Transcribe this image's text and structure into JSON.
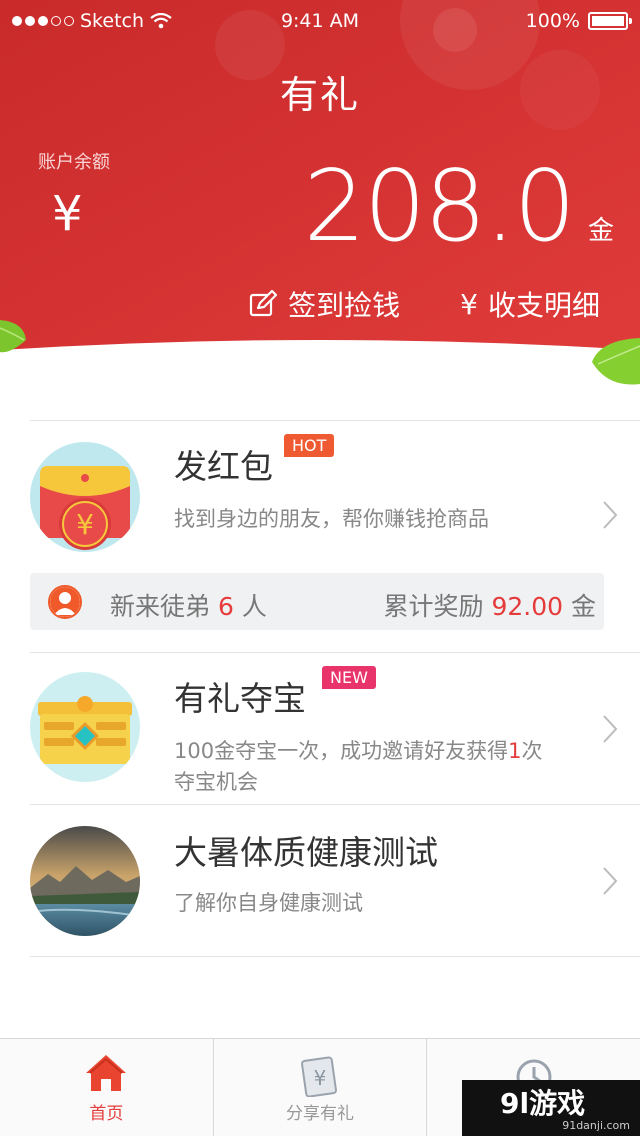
{
  "status_bar": {
    "carrier": "Sketch",
    "time": "9:41 AM",
    "battery": "100%"
  },
  "header": {
    "title": "有礼",
    "balance_label": "账户余额",
    "currency_symbol": "¥",
    "balance": "208.0",
    "unit": "金",
    "checkin_label": "签到捡钱",
    "records_label": "收支明细",
    "colors": {
      "header_red": "#d83131"
    }
  },
  "items": [
    {
      "title": "发红包",
      "badge": "HOT",
      "desc": "找到身边的朋友，帮你赚钱抢商品",
      "icon": "red-envelope-icon"
    },
    {
      "title": "有礼夺宝",
      "badge": "NEW",
      "desc_a": "100金夺宝一次，成功邀请好友获得",
      "desc_hl": "1",
      "desc_b": "次",
      "desc2": "夺宝机会",
      "icon": "treasure-chest-icon"
    },
    {
      "title": "大暑体质健康测试",
      "desc": "了解你自身健康测试",
      "icon": "landscape-photo"
    }
  ],
  "recruit": {
    "label": "新来徒弟",
    "count": "6",
    "count_unit": "人",
    "reward_label": "累计奖励",
    "reward": "92.00",
    "reward_unit": "金"
  },
  "tabbar": {
    "tabs": [
      {
        "label": "首页",
        "icon": "home-icon"
      },
      {
        "label": "分享有礼",
        "icon": "share-gift-icon"
      },
      {
        "label": "",
        "icon": "history-icon"
      }
    ],
    "accent": "#e53b3b"
  },
  "watermark": {
    "main": "9l游戏",
    "sub": "91danji.com"
  }
}
